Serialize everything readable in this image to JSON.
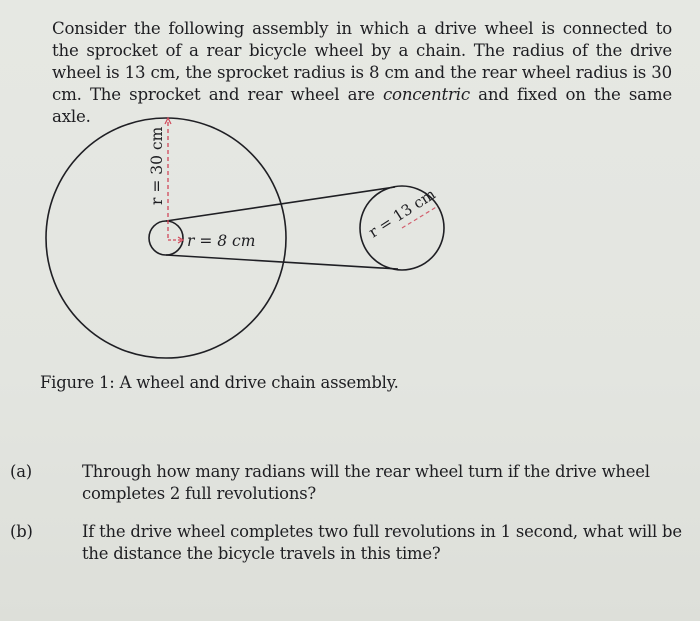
{
  "intro": {
    "part1": "Consider the following assembly in which a drive wheel is connected to the sprocket of a rear bicycle wheel by a chain. The radius of the drive wheel is 13 cm, the sprocket radius is 8 cm and the rear wheel radius is 30 cm. The sprocket and rear wheel are ",
    "emphasis": "concentric",
    "part2": " and fixed on the same axle."
  },
  "figure": {
    "rear_wheel_label": "r = 30 cm",
    "sprocket_label": "r = 8 cm",
    "drive_wheel_label": "r = 13 cm",
    "caption": "Figure 1: A wheel and drive chain assembly.",
    "colors": {
      "stroke": "#1f1f24",
      "radius_marker": "#d0485a"
    }
  },
  "questions": [
    {
      "label": "(a)",
      "text": "Through how many radians will the rear wheel turn if the drive wheel completes 2 full revolutions?"
    },
    {
      "label": "(b)",
      "text": "If the drive wheel completes two full revolutions in 1 second, what will be the distance the bicycle travels in this time?"
    }
  ]
}
